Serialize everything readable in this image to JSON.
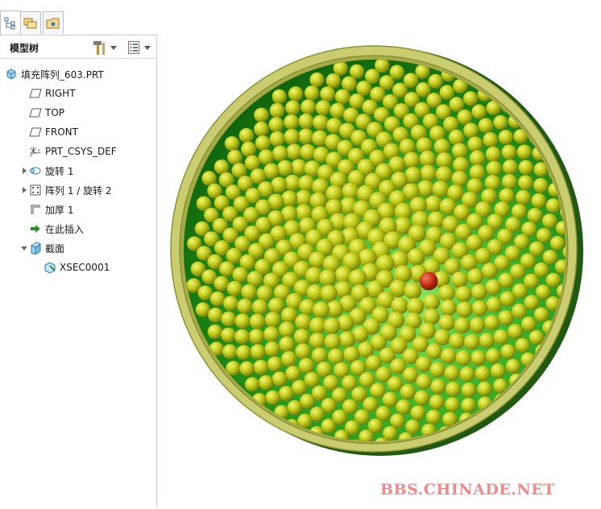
{
  "tabs": [
    {
      "name": "model-tree-tab-icon",
      "active": true
    },
    {
      "name": "folder-browser-tab-icon",
      "active": false
    },
    {
      "name": "favorites-tab-icon",
      "active": false
    }
  ],
  "tree_header": {
    "title": "模型树",
    "settings_icon": "hammer-icon",
    "show_icon": "list-icon"
  },
  "tree": {
    "items": [
      {
        "label": "填充阵列_603.PRT",
        "icon": "part-icon",
        "indent": 0,
        "expander": "none"
      },
      {
        "label": "RIGHT",
        "icon": "datum-plane-icon",
        "indent": 1,
        "expander": "none"
      },
      {
        "label": "TOP",
        "icon": "datum-plane-icon",
        "indent": 1,
        "expander": "none"
      },
      {
        "label": "FRONT",
        "icon": "datum-plane-icon",
        "indent": 1,
        "expander": "none"
      },
      {
        "label": "PRT_CSYS_DEF",
        "icon": "csys-icon",
        "indent": 1,
        "expander": "none"
      },
      {
        "label": "旋转 1",
        "icon": "revolve-icon",
        "indent": 1,
        "expander": "collapsed"
      },
      {
        "label": "阵列 1 / 旋转 2",
        "icon": "pattern-icon",
        "indent": 1,
        "expander": "collapsed"
      },
      {
        "label": "加厚 1",
        "icon": "thicken-icon",
        "indent": 1,
        "expander": "none"
      },
      {
        "label": "在此插入",
        "icon": "insert-here-icon",
        "indent": 1,
        "expander": "none"
      },
      {
        "label": "截面",
        "icon": "section-icon",
        "indent": 1,
        "expander": "expanded"
      },
      {
        "label": "XSEC0001",
        "icon": "xsec-icon",
        "indent": 2,
        "expander": "none"
      }
    ]
  },
  "viewport": {
    "watermark": "BBS.CHINADE.NET",
    "colors": {
      "rim": "#c8cc6a",
      "inner_green_light": "#7ee05a",
      "inner_green_dark": "#0f6a0a",
      "ball": "#c9d21e",
      "ball_dark": "#6f7a08",
      "highlight_ball": "#c8301a"
    }
  }
}
